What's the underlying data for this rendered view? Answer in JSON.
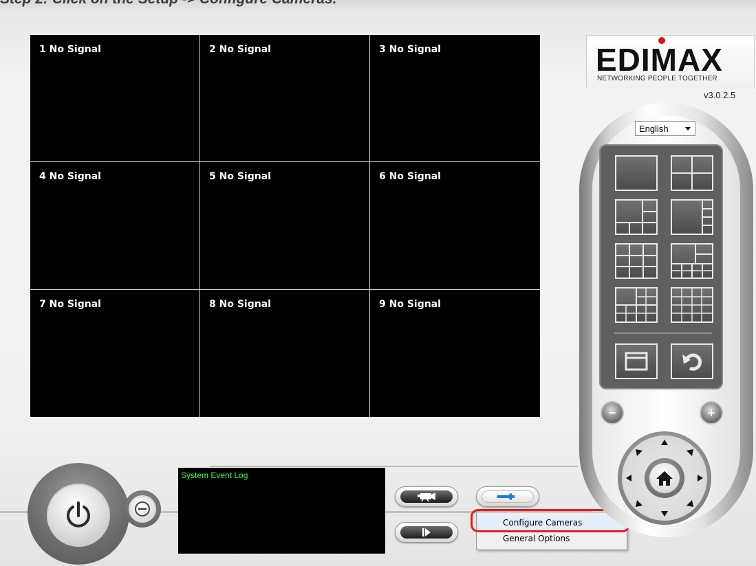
{
  "step_title": "Step 2: Click on the Setup -> Configure Cameras.",
  "cameras": [
    {
      "label": "1 No Signal"
    },
    {
      "label": "2 No Signal"
    },
    {
      "label": "3 No Signal"
    },
    {
      "label": "4 No Signal"
    },
    {
      "label": "5 No Signal"
    },
    {
      "label": "6 No Signal"
    },
    {
      "label": "7 No Signal"
    },
    {
      "label": "8 No Signal"
    },
    {
      "label": "9 No Signal"
    }
  ],
  "logo": {
    "wordmark": "EDIMAX",
    "tagline": "NETWORKING PEOPLE TOGETHER"
  },
  "version": "v3.0.2.5",
  "language": {
    "selected": "English"
  },
  "event_log": {
    "title": "System Event Log"
  },
  "setup_menu": {
    "items": [
      "Configure Cameras",
      "General Options"
    ],
    "highlighted_index": 0
  },
  "colors": {
    "log_text": "#39ff39",
    "highlight_ring": "#e51e1e",
    "brand_dot": "#e01010"
  }
}
